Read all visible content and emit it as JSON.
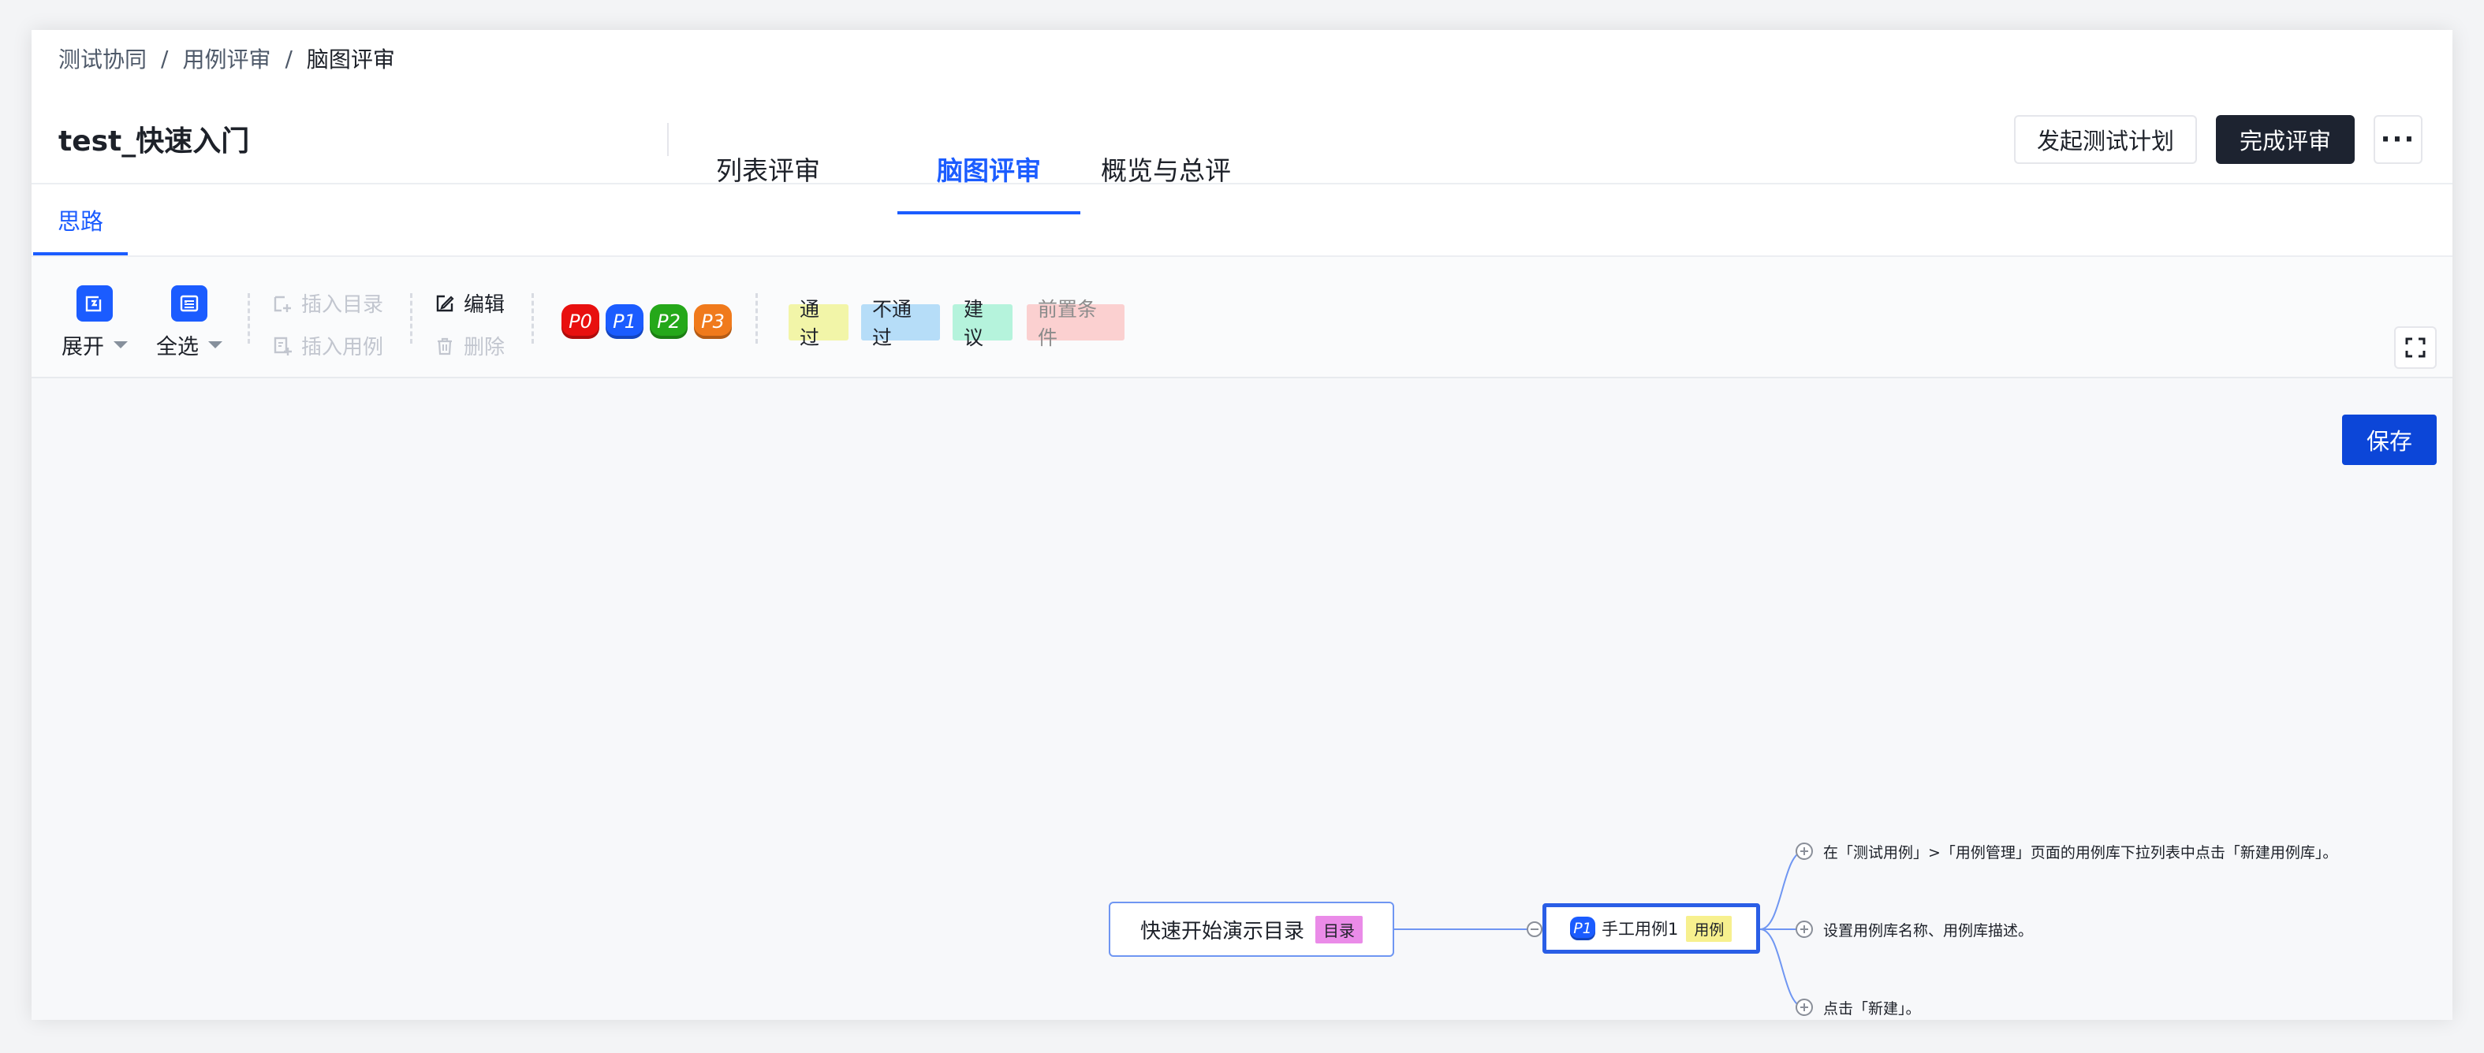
{
  "breadcrumb": {
    "item1": "测试协同",
    "item2": "用例评审",
    "item3": "脑图评审",
    "separator": "/"
  },
  "header": {
    "title": "test_快速入门",
    "tabs": [
      {
        "label": "列表评审",
        "active": false
      },
      {
        "label": "脑图评审",
        "active": true
      },
      {
        "label": "概览与总评",
        "active": false
      }
    ],
    "buttons": {
      "plan": "发起测试计划",
      "finish": "完成评审",
      "more": "···"
    }
  },
  "subtab": {
    "label": "思路"
  },
  "toolbar": {
    "expand": {
      "label": "展开",
      "icon": "expand-icon"
    },
    "select_all": {
      "label": "全选",
      "icon": "select-all-icon"
    },
    "insert_dir": "插入目录",
    "insert_case": "插入用例",
    "edit": "编辑",
    "delete": "删除",
    "priorities": [
      {
        "label": "P0",
        "color": "#e8100f"
      },
      {
        "label": "P1",
        "color": "#1b5cff"
      },
      {
        "label": "P2",
        "color": "#25a81a"
      },
      {
        "label": "P3",
        "color": "#f07a1c"
      }
    ],
    "tags": [
      {
        "label": "通过",
        "bg": "#f2f5a8",
        "color": "#1d2129"
      },
      {
        "label": "不通过",
        "bg": "#b6ddf8",
        "color": "#1d2129"
      },
      {
        "label": "建议",
        "bg": "#b5f3dc",
        "color": "#1d2129"
      },
      {
        "label": "前置条件",
        "bg": "#fbd0d0",
        "color": "#8c8c8c"
      }
    ],
    "fullscreen_icon": "fullscreen-icon"
  },
  "canvas": {
    "save": "保存",
    "root_node": {
      "label": "快速开始演示目录",
      "badge": "目录"
    },
    "case_node": {
      "priority": "P1",
      "label": "手工用例1",
      "badge": "用例"
    },
    "steps": [
      "在「测试用例」>「用例管理」页面的用例库下拉列表中点击「新建用例库」。",
      "设置用例库名称、用例库描述。",
      "点击「新建」。"
    ]
  },
  "colors": {
    "accent": "#1b5cff",
    "dark_button": "#1d2330",
    "save_button": "#0c46d8"
  }
}
